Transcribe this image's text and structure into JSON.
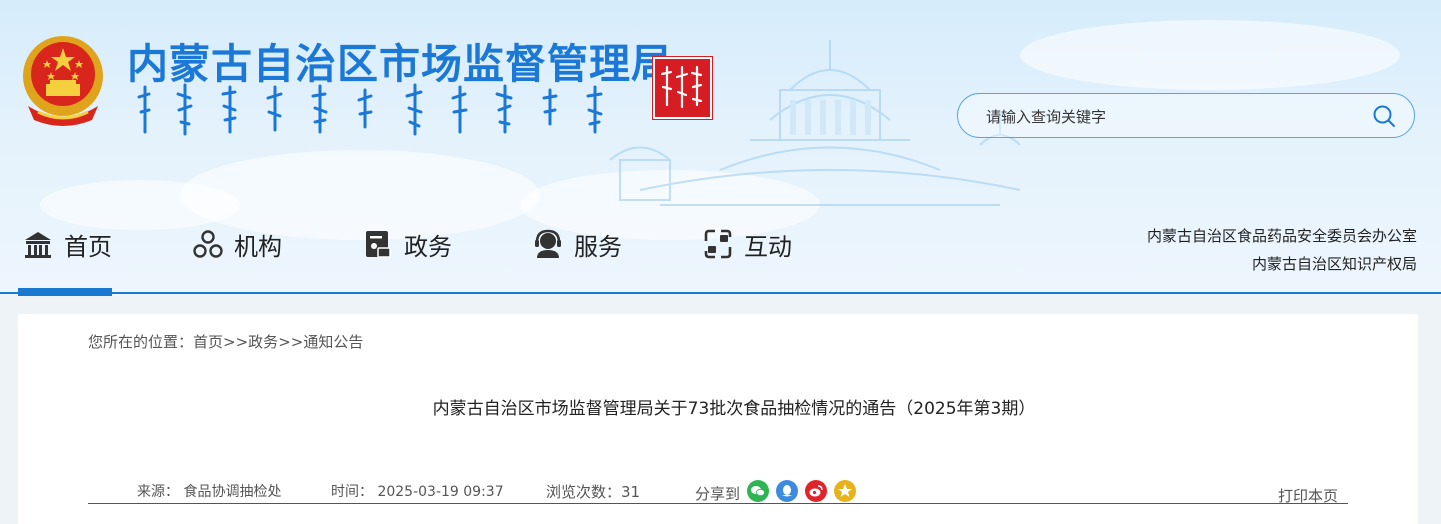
{
  "header": {
    "site_title": "内蒙古自治区市场监督管理局",
    "emblem": "national-emblem",
    "seal": "red-seal"
  },
  "search": {
    "placeholder": "请输入查询关键字",
    "icon": "search-icon"
  },
  "nav": {
    "items": [
      {
        "label": "首页",
        "icon": "home-icon",
        "active": true
      },
      {
        "label": "机构",
        "icon": "people-icon"
      },
      {
        "label": "政务",
        "icon": "document-icon"
      },
      {
        "label": "服务",
        "icon": "customer-service-icon"
      },
      {
        "label": "互动",
        "icon": "interaction-icon"
      }
    ],
    "partner_links": [
      "内蒙古自治区食品药品安全委员会办公室",
      "内蒙古自治区知识产权局"
    ],
    "accent_color": "#1a78d0"
  },
  "breadcrumb": {
    "prefix": "您所在的位置：",
    "items": [
      "首页",
      "政务",
      "通知公告"
    ],
    "separator": ">>"
  },
  "article": {
    "title": "内蒙古自治区市场监督管理局关于73批次食品抽检情况的通告（2025年第3期）",
    "source_label": "来源：",
    "source": "食品协调抽检处",
    "time_label": "时间：",
    "time": "2025-03-19 09:37",
    "views_label": "浏览次数：",
    "views": "31",
    "share_label": "分享到",
    "share_icons": [
      {
        "name": "wechat-icon",
        "color": "#2fb454"
      },
      {
        "name": "qq-icon",
        "color": "#3d8bde"
      },
      {
        "name": "weibo-icon",
        "color": "#e0242a"
      },
      {
        "name": "qzone-icon",
        "color": "#e8b21a"
      }
    ],
    "print_label": "打印本页"
  }
}
